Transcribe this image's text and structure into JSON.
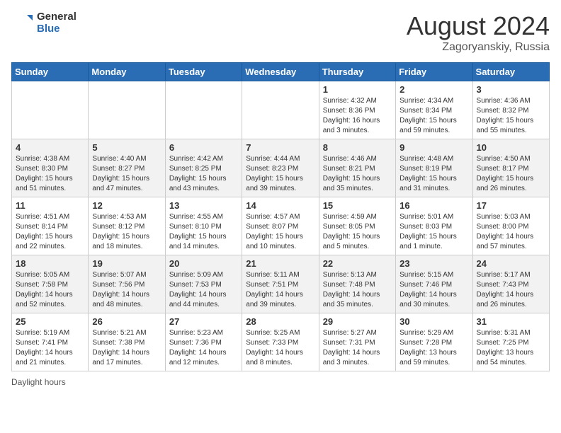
{
  "app": {
    "logo_text_general": "General",
    "logo_text_blue": "Blue"
  },
  "title": {
    "month_year": "August 2024",
    "location": "Zagoryanskiy, Russia"
  },
  "days_of_week": [
    "Sunday",
    "Monday",
    "Tuesday",
    "Wednesday",
    "Thursday",
    "Friday",
    "Saturday"
  ],
  "footer": {
    "label": "Daylight hours"
  },
  "weeks": [
    [
      {
        "day": "",
        "info": ""
      },
      {
        "day": "",
        "info": ""
      },
      {
        "day": "",
        "info": ""
      },
      {
        "day": "",
        "info": ""
      },
      {
        "day": "1",
        "info": "Sunrise: 4:32 AM\nSunset: 8:36 PM\nDaylight: 16 hours\nand 3 minutes."
      },
      {
        "day": "2",
        "info": "Sunrise: 4:34 AM\nSunset: 8:34 PM\nDaylight: 15 hours\nand 59 minutes."
      },
      {
        "day": "3",
        "info": "Sunrise: 4:36 AM\nSunset: 8:32 PM\nDaylight: 15 hours\nand 55 minutes."
      }
    ],
    [
      {
        "day": "4",
        "info": "Sunrise: 4:38 AM\nSunset: 8:30 PM\nDaylight: 15 hours\nand 51 minutes."
      },
      {
        "day": "5",
        "info": "Sunrise: 4:40 AM\nSunset: 8:27 PM\nDaylight: 15 hours\nand 47 minutes."
      },
      {
        "day": "6",
        "info": "Sunrise: 4:42 AM\nSunset: 8:25 PM\nDaylight: 15 hours\nand 43 minutes."
      },
      {
        "day": "7",
        "info": "Sunrise: 4:44 AM\nSunset: 8:23 PM\nDaylight: 15 hours\nand 39 minutes."
      },
      {
        "day": "8",
        "info": "Sunrise: 4:46 AM\nSunset: 8:21 PM\nDaylight: 15 hours\nand 35 minutes."
      },
      {
        "day": "9",
        "info": "Sunrise: 4:48 AM\nSunset: 8:19 PM\nDaylight: 15 hours\nand 31 minutes."
      },
      {
        "day": "10",
        "info": "Sunrise: 4:50 AM\nSunset: 8:17 PM\nDaylight: 15 hours\nand 26 minutes."
      }
    ],
    [
      {
        "day": "11",
        "info": "Sunrise: 4:51 AM\nSunset: 8:14 PM\nDaylight: 15 hours\nand 22 minutes."
      },
      {
        "day": "12",
        "info": "Sunrise: 4:53 AM\nSunset: 8:12 PM\nDaylight: 15 hours\nand 18 minutes."
      },
      {
        "day": "13",
        "info": "Sunrise: 4:55 AM\nSunset: 8:10 PM\nDaylight: 15 hours\nand 14 minutes."
      },
      {
        "day": "14",
        "info": "Sunrise: 4:57 AM\nSunset: 8:07 PM\nDaylight: 15 hours\nand 10 minutes."
      },
      {
        "day": "15",
        "info": "Sunrise: 4:59 AM\nSunset: 8:05 PM\nDaylight: 15 hours\nand 5 minutes."
      },
      {
        "day": "16",
        "info": "Sunrise: 5:01 AM\nSunset: 8:03 PM\nDaylight: 15 hours\nand 1 minute."
      },
      {
        "day": "17",
        "info": "Sunrise: 5:03 AM\nSunset: 8:00 PM\nDaylight: 14 hours\nand 57 minutes."
      }
    ],
    [
      {
        "day": "18",
        "info": "Sunrise: 5:05 AM\nSunset: 7:58 PM\nDaylight: 14 hours\nand 52 minutes."
      },
      {
        "day": "19",
        "info": "Sunrise: 5:07 AM\nSunset: 7:56 PM\nDaylight: 14 hours\nand 48 minutes."
      },
      {
        "day": "20",
        "info": "Sunrise: 5:09 AM\nSunset: 7:53 PM\nDaylight: 14 hours\nand 44 minutes."
      },
      {
        "day": "21",
        "info": "Sunrise: 5:11 AM\nSunset: 7:51 PM\nDaylight: 14 hours\nand 39 minutes."
      },
      {
        "day": "22",
        "info": "Sunrise: 5:13 AM\nSunset: 7:48 PM\nDaylight: 14 hours\nand 35 minutes."
      },
      {
        "day": "23",
        "info": "Sunrise: 5:15 AM\nSunset: 7:46 PM\nDaylight: 14 hours\nand 30 minutes."
      },
      {
        "day": "24",
        "info": "Sunrise: 5:17 AM\nSunset: 7:43 PM\nDaylight: 14 hours\nand 26 minutes."
      }
    ],
    [
      {
        "day": "25",
        "info": "Sunrise: 5:19 AM\nSunset: 7:41 PM\nDaylight: 14 hours\nand 21 minutes."
      },
      {
        "day": "26",
        "info": "Sunrise: 5:21 AM\nSunset: 7:38 PM\nDaylight: 14 hours\nand 17 minutes."
      },
      {
        "day": "27",
        "info": "Sunrise: 5:23 AM\nSunset: 7:36 PM\nDaylight: 14 hours\nand 12 minutes."
      },
      {
        "day": "28",
        "info": "Sunrise: 5:25 AM\nSunset: 7:33 PM\nDaylight: 14 hours\nand 8 minutes."
      },
      {
        "day": "29",
        "info": "Sunrise: 5:27 AM\nSunset: 7:31 PM\nDaylight: 14 hours\nand 3 minutes."
      },
      {
        "day": "30",
        "info": "Sunrise: 5:29 AM\nSunset: 7:28 PM\nDaylight: 13 hours\nand 59 minutes."
      },
      {
        "day": "31",
        "info": "Sunrise: 5:31 AM\nSunset: 7:25 PM\nDaylight: 13 hours\nand 54 minutes."
      }
    ]
  ]
}
